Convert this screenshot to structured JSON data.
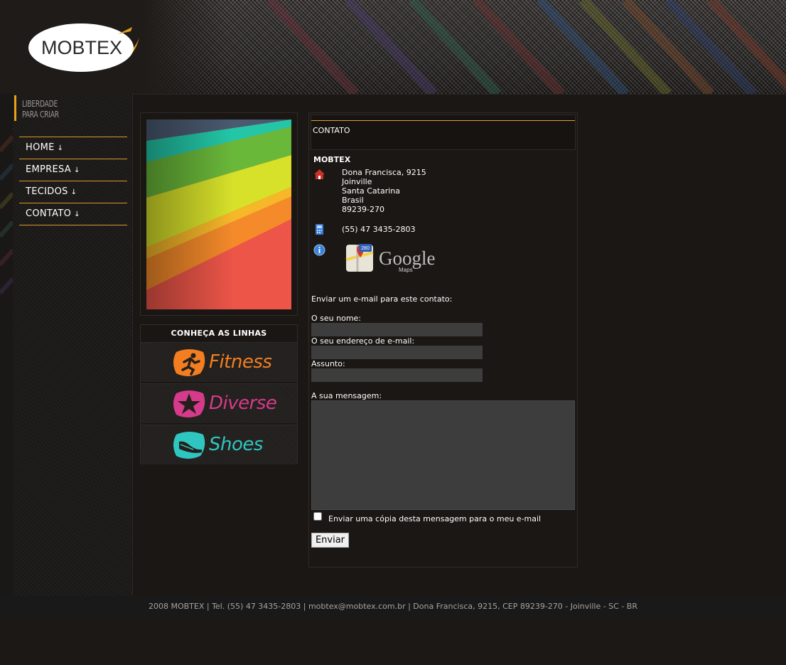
{
  "brand": {
    "logo_text": "MOBTEX",
    "slogan_line1": "LIBERDADE",
    "slogan_line2": "PARA CRIAR",
    "accent_color": "#e8a21b"
  },
  "nav": {
    "items": [
      {
        "label": "HOME",
        "arrow": "↓"
      },
      {
        "label": "EMPRESA",
        "arrow": "↓"
      },
      {
        "label": "TECIDOS",
        "arrow": "↓"
      },
      {
        "label": "CONTATO",
        "arrow": "↓"
      }
    ]
  },
  "lines": {
    "title": "CONHEÇA AS LINHAS",
    "items": [
      {
        "label": "Fitness",
        "color": "#f27e21",
        "icon": "runner-icon"
      },
      {
        "label": "Diverse",
        "color": "#d63a8a",
        "icon": "star-icon"
      },
      {
        "label": "Shoes",
        "color": "#2fc6c1",
        "icon": "shoe-icon"
      }
    ]
  },
  "contact": {
    "section_title": "CONTATO",
    "company": "MOBTEX",
    "address": {
      "street": "Dona Francisca, 9215",
      "city": "Joinville",
      "state": "Santa Catarina",
      "country": "Brasil",
      "zip": "89239-270"
    },
    "phone": "(55) 47 3435-2803",
    "maps_label": "Google",
    "maps_sub": "Maps",
    "maps_badge": "280"
  },
  "form": {
    "intro": "Enviar um e-mail para este contato:",
    "name_label": "O seu nome:",
    "name_value": "",
    "email_label": "O seu endereço de e-mail:",
    "email_value": "",
    "subject_label": "Assunto:",
    "subject_value": "",
    "message_label": "A sua mensagem:",
    "message_value": "",
    "copy_label": "Enviar uma cópia desta mensagem para o meu e-mail",
    "submit_label": "Enviar"
  },
  "footer": {
    "text": "2008 MOBTEX | Tel. (55) 47 3435-2803 | mobtex@mobtex.com.br | Dona Francisca, 9215, CEP 89239-270 - Joinville - SC - BR"
  }
}
